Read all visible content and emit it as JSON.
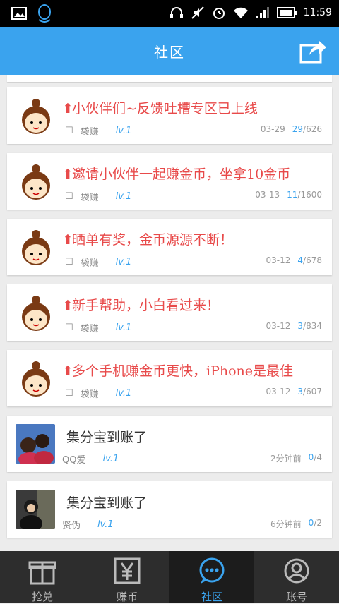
{
  "status": {
    "time": "11:59"
  },
  "header": {
    "title": "社区"
  },
  "posts": [
    {
      "title": "小伙伴们~反馈吐槽专区已上线",
      "author": "袋赚",
      "level": "lv.1",
      "date": "03-29",
      "replies": "29",
      "views": "/626"
    },
    {
      "title": "邀请小伙伴一起赚金币，坐拿10金币",
      "author": "袋赚",
      "level": "lv.1",
      "date": "03-13",
      "replies": "11",
      "views": "/1600"
    },
    {
      "title": "晒单有奖，金币源源不断！",
      "author": "袋赚",
      "level": "lv.1",
      "date": "03-12",
      "replies": "4",
      "views": "/678"
    },
    {
      "title": "新手帮助，小白看过来！",
      "author": "袋赚",
      "level": "lv.1",
      "date": "03-12",
      "replies": "3",
      "views": "/834"
    },
    {
      "title": "多个手机赚金币更快，iPhone是最佳",
      "author": "袋赚",
      "level": "lv.1",
      "date": "03-12",
      "replies": "3",
      "views": "/607"
    }
  ],
  "user_posts": [
    {
      "title": "集分宝到账了",
      "author": "QQ爱",
      "level": "lv.1",
      "date": "2分钟前",
      "replies": "0",
      "views": "/4"
    },
    {
      "title": "集分宝到账了",
      "author": "贤伪",
      "level": "lv.1",
      "date": "6分钟前",
      "replies": "0",
      "views": "/2"
    }
  ],
  "tabs": [
    {
      "label": "抢兑",
      "icon": "gift-icon"
    },
    {
      "label": "赚币",
      "icon": "yen-icon"
    },
    {
      "label": "社区",
      "icon": "chat-bubble-icon"
    },
    {
      "label": "账号",
      "icon": "account-icon"
    }
  ],
  "colors": {
    "accent": "#3aa3ee",
    "pin": "#e84a4a",
    "tabbar": "#2d2d2d"
  }
}
